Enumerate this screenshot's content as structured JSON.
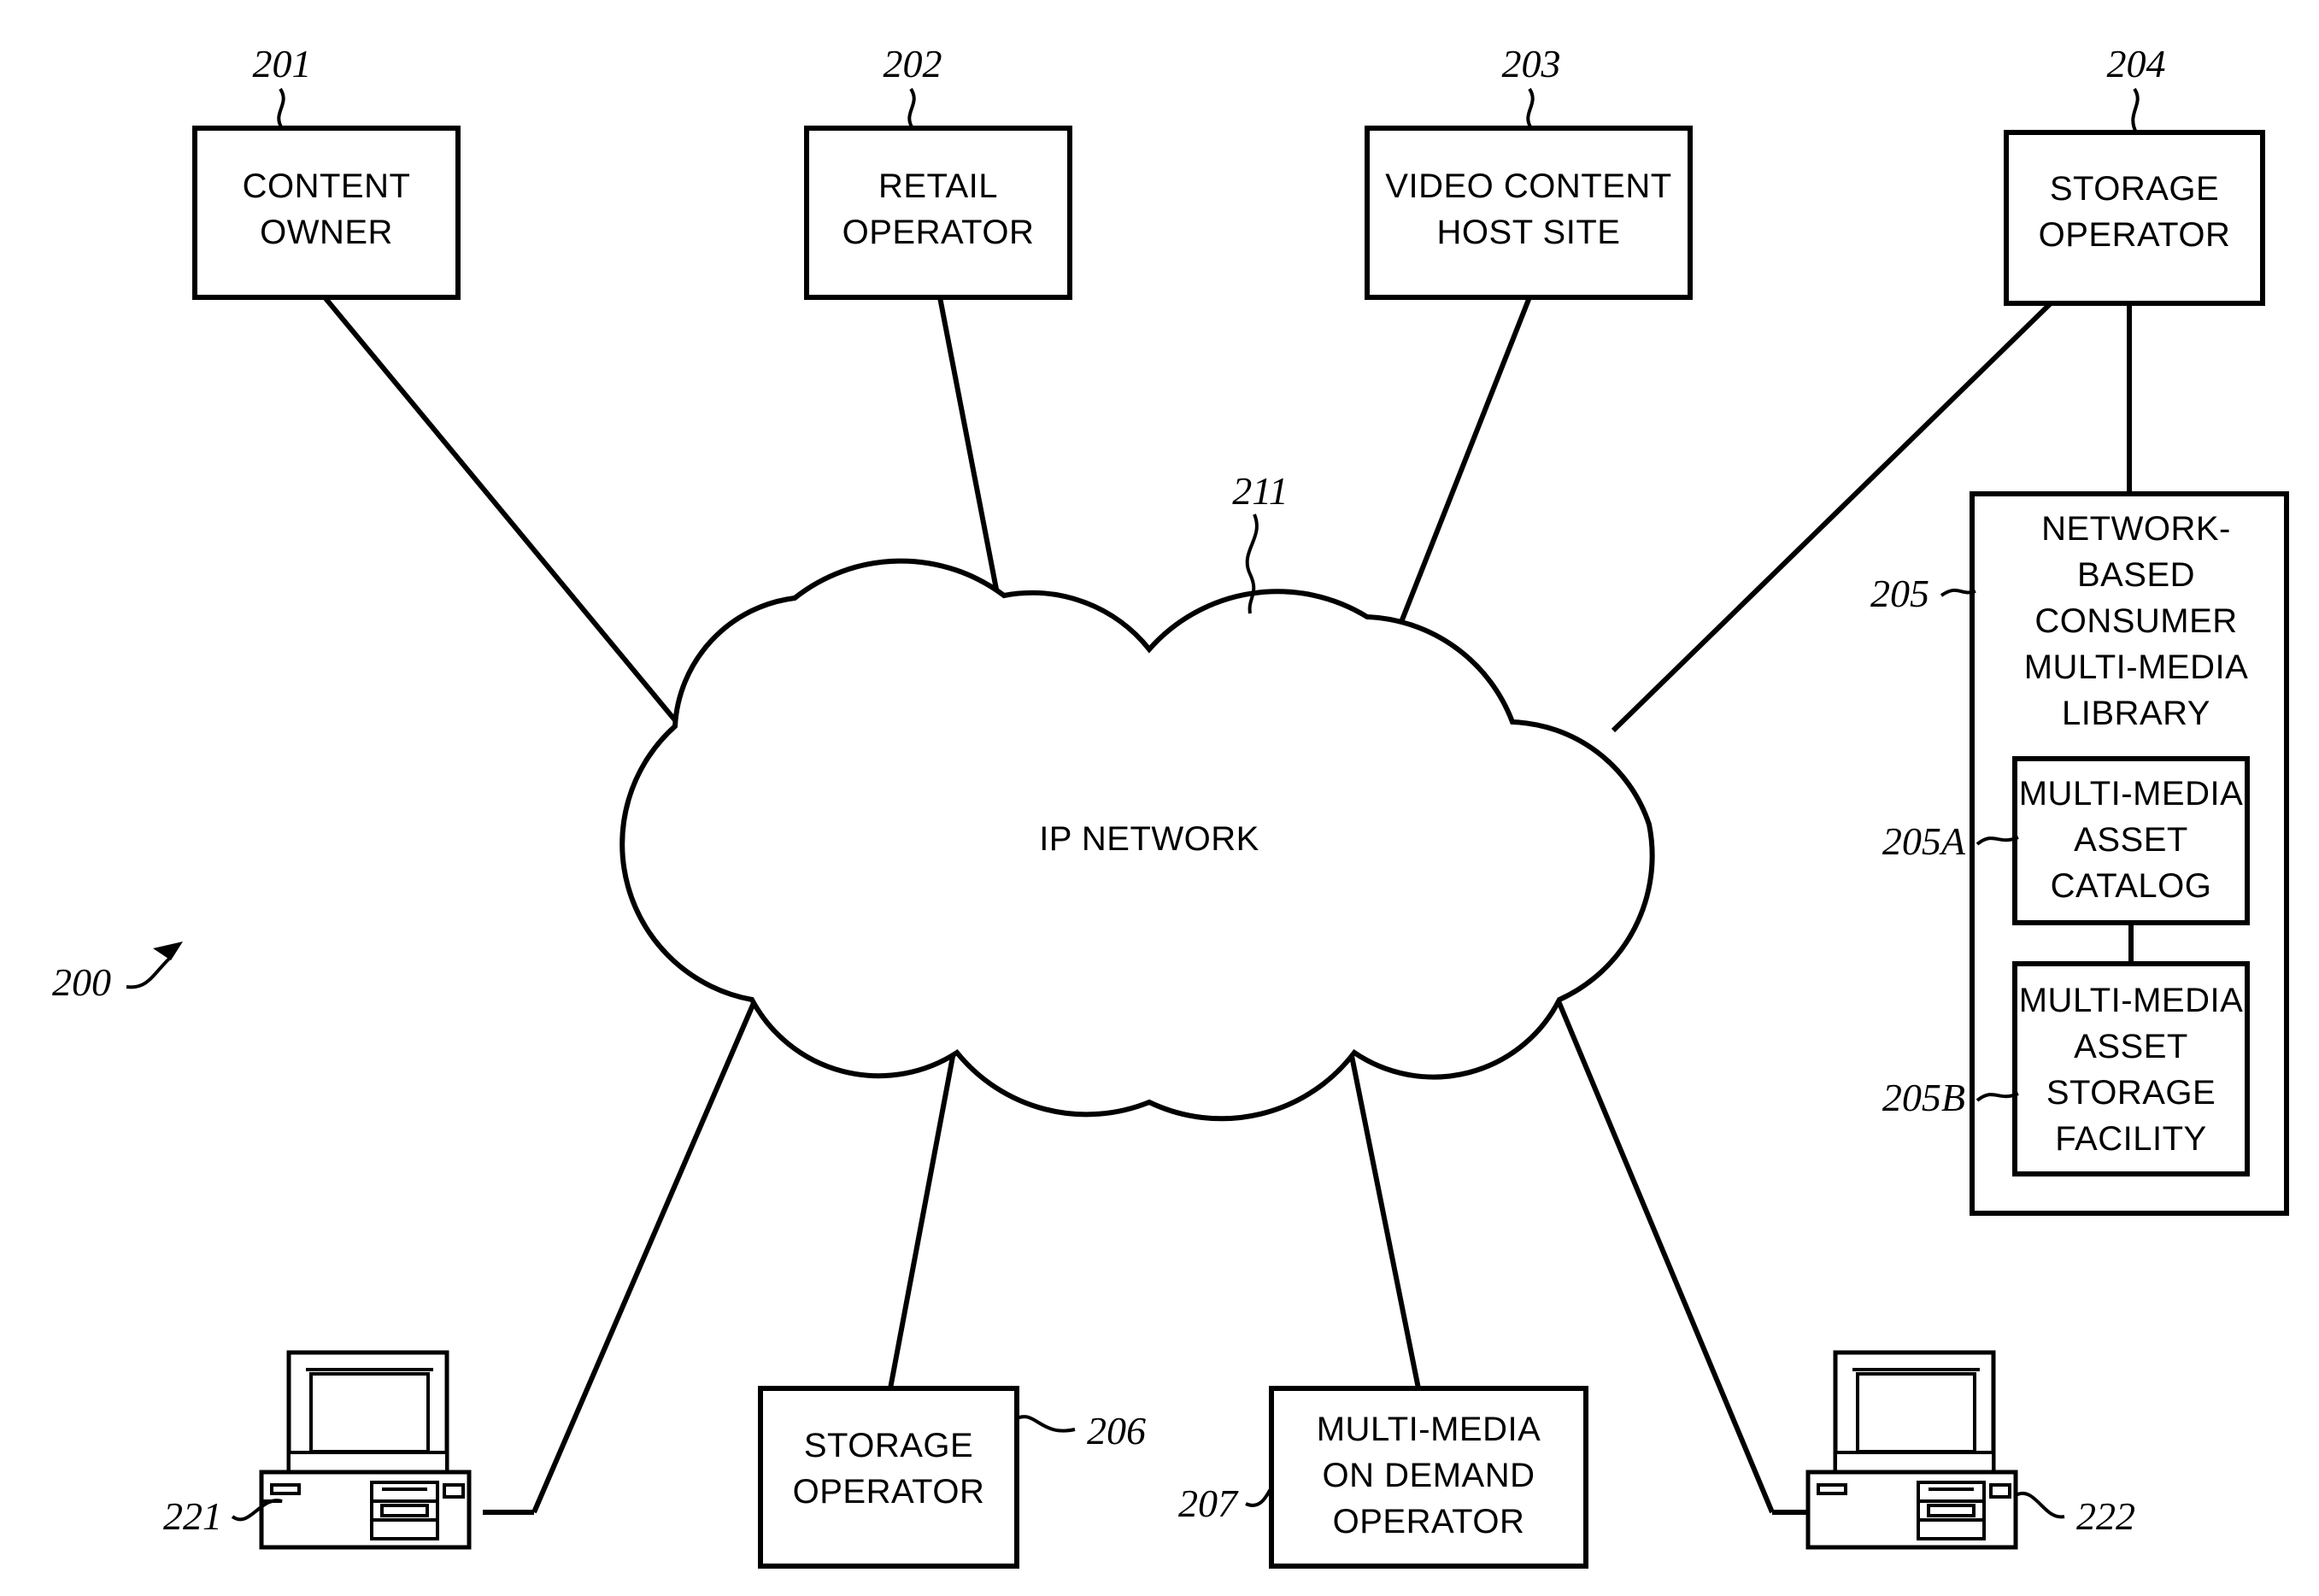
{
  "figure": {
    "figure_ref": "200",
    "nodes": [
      {
        "ref": "201",
        "label_line1": "CONTENT",
        "label_line2": "OWNER"
      },
      {
        "ref": "202",
        "label_line1": "RETAIL",
        "label_line2": "OPERATOR"
      },
      {
        "ref": "203",
        "label_line1": "VIDEO CONTENT",
        "label_line2": "HOST SITE"
      },
      {
        "ref": "204",
        "label_line1": "STORAGE",
        "label_line2": "OPERATOR"
      },
      {
        "ref": "206",
        "label_line1": "STORAGE",
        "label_line2": "OPERATOR"
      },
      {
        "ref": "207",
        "label_line1": "MULTI-MEDIA",
        "label_line2": "ON DEMAND",
        "label_line3": "OPERATOR"
      }
    ],
    "cloud": {
      "ref": "211",
      "label": "IP NETWORK"
    },
    "library": {
      "ref": "205",
      "title_lines": [
        "NETWORK-",
        "BASED",
        "CONSUMER",
        "MULTI-MEDIA",
        "LIBRARY"
      ],
      "children": [
        {
          "ref": "205A",
          "lines": [
            "MULTI-MEDIA",
            "ASSET",
            "CATALOG"
          ]
        },
        {
          "ref": "205B",
          "lines": [
            "MULTI-MEDIA",
            "ASSET",
            "STORAGE",
            "FACILITY"
          ]
        }
      ]
    },
    "terminals": [
      {
        "ref": "221",
        "icon": "desktop-computer-icon"
      },
      {
        "ref": "222",
        "icon": "desktop-computer-icon"
      }
    ]
  }
}
